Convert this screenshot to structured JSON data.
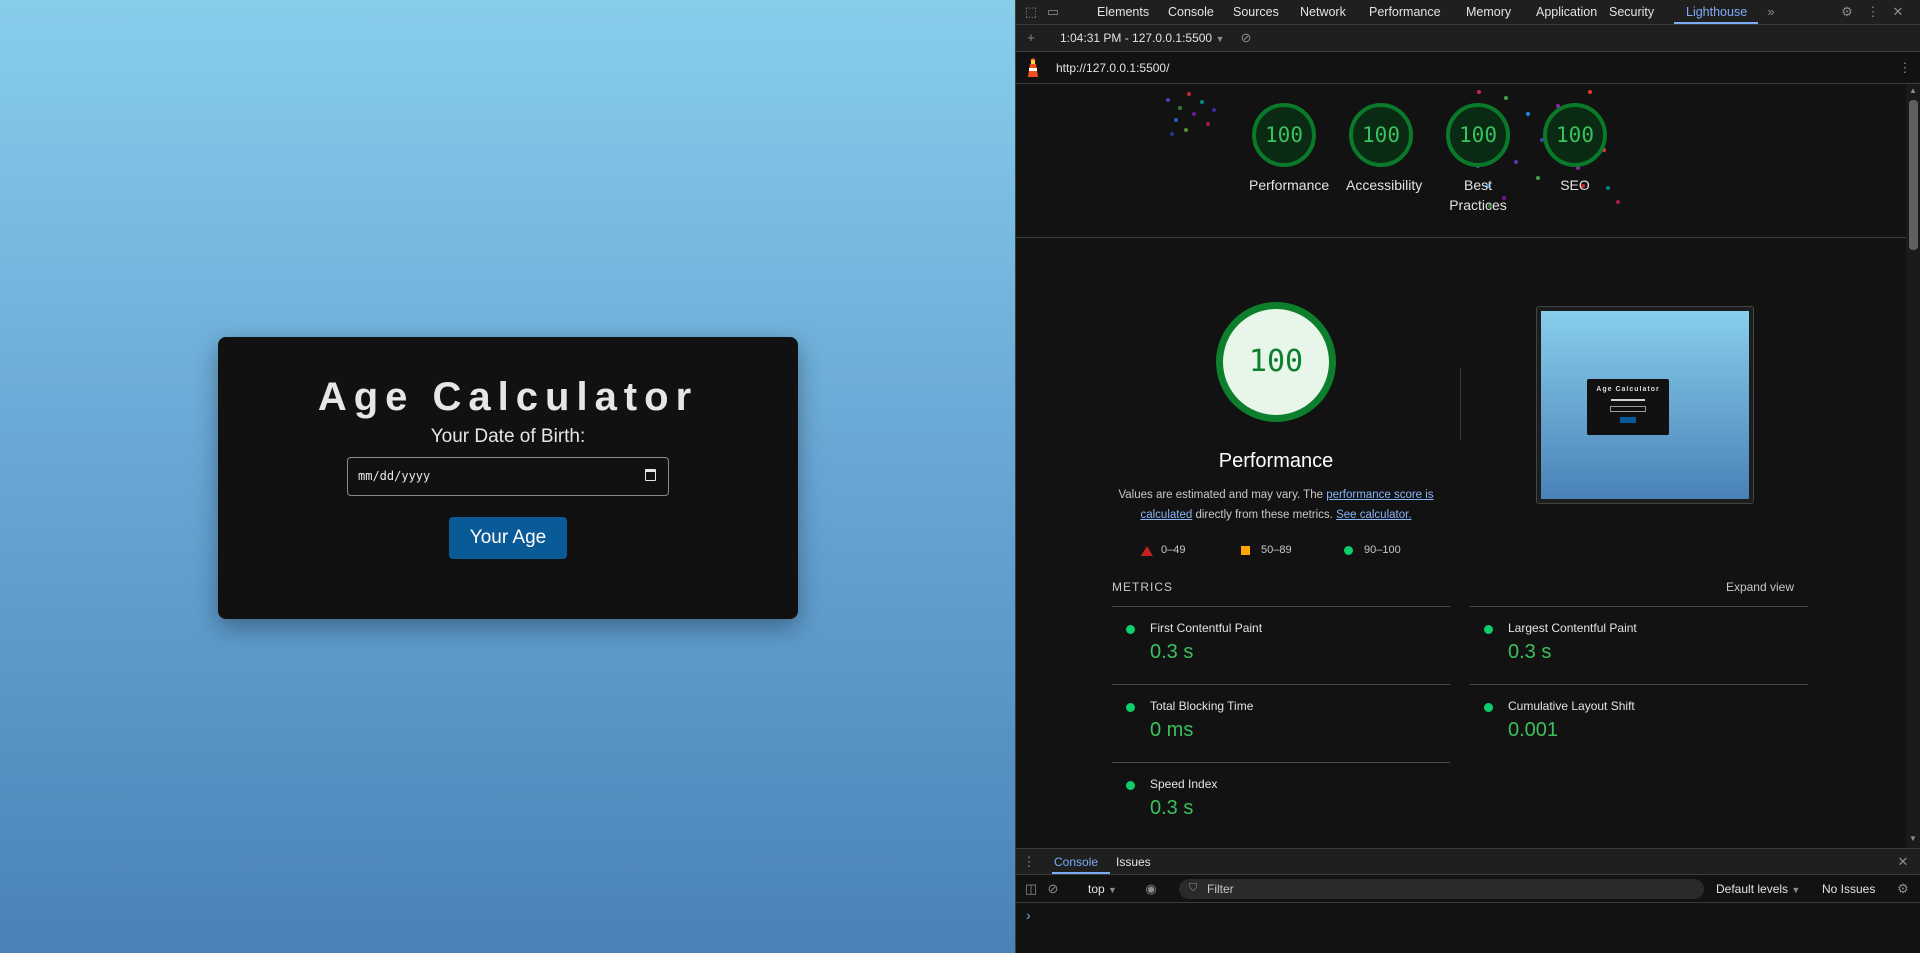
{
  "page": {
    "title": "Age Calculator",
    "dob_label": "Your Date of Birth:",
    "dob_placeholder": "mm/dd/yyyy",
    "submit_label": "Your Age",
    "accent": "#0a5a97"
  },
  "devtools": {
    "tabs": [
      "Elements",
      "Console",
      "Sources",
      "Network",
      "Performance",
      "Memory",
      "Application",
      "Security",
      "Lighthouse"
    ],
    "active_tab": "Lighthouse",
    "more_tabs_icon": "chevron-double-right-icon",
    "report_select": "1:04:31 PM - 127.0.0.1:5500",
    "url": "http://127.0.0.1:5500/",
    "scores": [
      {
        "label": "Performance",
        "score": "100"
      },
      {
        "label": "Accessibility",
        "score": "100"
      },
      {
        "label": "Best Practices",
        "score": "100"
      },
      {
        "label": "SEO",
        "score": "100"
      }
    ],
    "performance": {
      "score": "100",
      "title": "Performance",
      "desc_prefix": "Values are estimated and may vary. The ",
      "desc_link1": "performance score is calculated",
      "desc_mid": " directly from these metrics. ",
      "desc_link2": "See calculator."
    },
    "legend": [
      {
        "range": "0–49",
        "color": "#c5221f",
        "shape": "triangle"
      },
      {
        "range": "50–89",
        "color": "#ffa400",
        "shape": "square"
      },
      {
        "range": "90–100",
        "color": "#0cce6b",
        "shape": "circle"
      }
    ],
    "metrics_label": "METRICS",
    "expand_label": "Expand view",
    "metrics": [
      {
        "name": "First Contentful Paint",
        "value": "0.3 s"
      },
      {
        "name": "Largest Contentful Paint",
        "value": "0.3 s"
      },
      {
        "name": "Total Blocking Time",
        "value": "0 ms"
      },
      {
        "name": "Cumulative Layout Shift",
        "value": "0.001"
      },
      {
        "name": "Speed Index",
        "value": "0.3 s"
      }
    ],
    "drawer_tabs": [
      "Console",
      "Issues"
    ],
    "context": "top",
    "filter_placeholder": "Filter",
    "levels": "Default levels",
    "issues": "No Issues",
    "prompt": "›",
    "good_color": "#0cce6b"
  }
}
